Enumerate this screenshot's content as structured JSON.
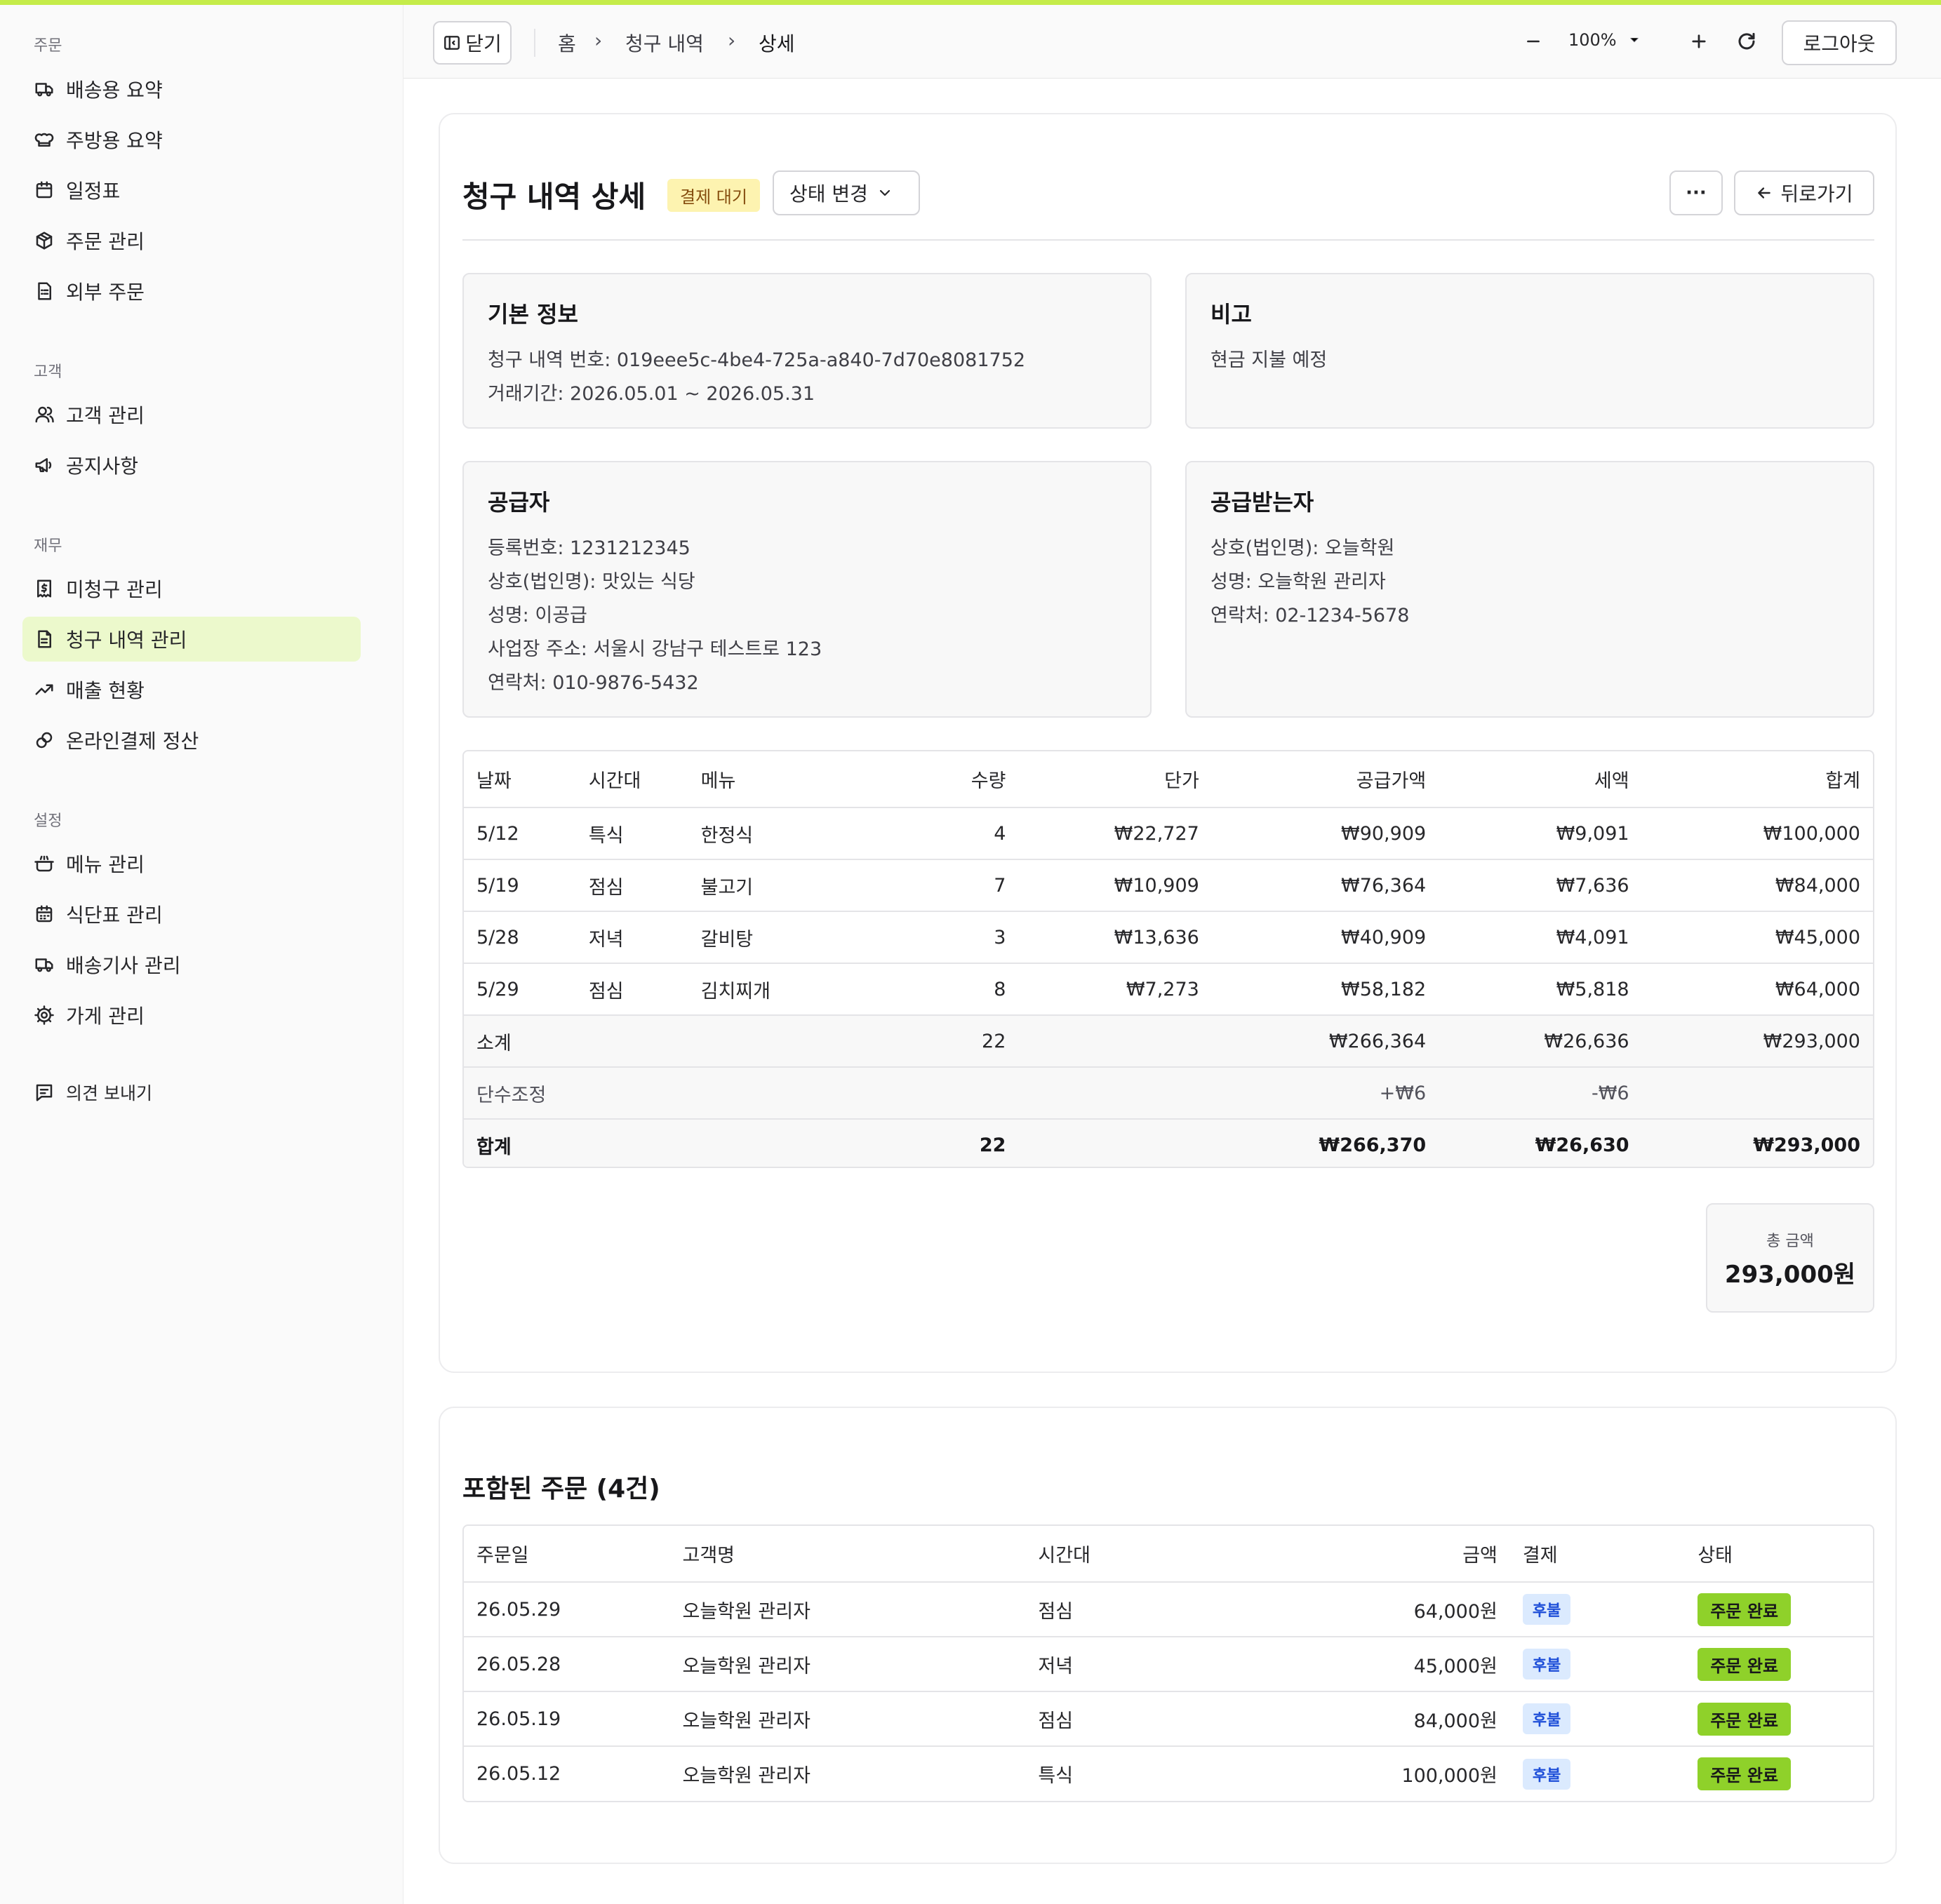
{
  "sidebar": {
    "sections": [
      {
        "title": "주문",
        "items": [
          {
            "label": "배송용 요약",
            "icon": "truck-icon"
          },
          {
            "label": "주방용 요약",
            "icon": "chef-hat-icon"
          },
          {
            "label": "일정표",
            "icon": "calendar-icon"
          },
          {
            "label": "주문 관리",
            "icon": "package-icon"
          },
          {
            "label": "외부 주문",
            "icon": "document-list-icon"
          }
        ]
      },
      {
        "title": "고객",
        "items": [
          {
            "label": "고객 관리",
            "icon": "user-icon"
          },
          {
            "label": "공지사항",
            "icon": "megaphone-icon"
          }
        ]
      },
      {
        "title": "재무",
        "items": [
          {
            "label": "미청구 관리",
            "icon": "receipt-dollar-icon"
          },
          {
            "label": "청구 내역 관리",
            "icon": "document-icon",
            "active": true
          },
          {
            "label": "매출 현황",
            "icon": "trending-up-icon"
          },
          {
            "label": "온라인결제 정산",
            "icon": "coins-icon"
          }
        ]
      },
      {
        "title": "설정",
        "items": [
          {
            "label": "메뉴 관리",
            "icon": "cooking-pot-icon"
          },
          {
            "label": "식단표 관리",
            "icon": "calendar-grid-icon"
          },
          {
            "label": "배송기사 관리",
            "icon": "truck-icon"
          },
          {
            "label": "가게 관리",
            "icon": "gear-icon"
          }
        ]
      }
    ],
    "feedback_label": "의견 보내기"
  },
  "topbar": {
    "close_label": "닫기",
    "breadcrumb": [
      "홈",
      "청구 내역",
      "상세"
    ],
    "zoom": "100%",
    "logout_label": "로그아웃"
  },
  "detail": {
    "title": "청구 내역 상세",
    "status_badge": "결제 대기",
    "status_change_label": "상태 변경",
    "more_label": "···",
    "back_label": "뒤로가기"
  },
  "basic_info": {
    "title": "기본 정보",
    "invoice_no": "청구 내역 번호: 019eee5c-4be4-725a-a840-7d70e8081752",
    "period": "거래기간: 2026.05.01 ~ 2026.05.31"
  },
  "note": {
    "title": "비고",
    "text": "현금 지불 예정"
  },
  "supplier": {
    "title": "공급자",
    "lines": [
      "등록번호: 1231212345",
      "상호(법인명): 맛있는 식당",
      "성명: 이공급",
      "사업장 주소: 서울시 강남구 테스트로 123",
      "연락처: 010-9876-5432"
    ]
  },
  "recipient": {
    "title": "공급받는자",
    "lines": [
      "상호(법인명): 오늘학원",
      "성명: 오늘학원 관리자",
      "연락처: 02-1234-5678"
    ]
  },
  "items_table": {
    "headers": [
      "날짜",
      "시간대",
      "메뉴",
      "수량",
      "단가",
      "공급가액",
      "세액",
      "합계"
    ],
    "rows": [
      [
        "5/12",
        "특식",
        "한정식",
        "4",
        "₩22,727",
        "₩90,909",
        "₩9,091",
        "₩100,000"
      ],
      [
        "5/19",
        "점심",
        "불고기",
        "7",
        "₩10,909",
        "₩76,364",
        "₩7,636",
        "₩84,000"
      ],
      [
        "5/28",
        "저녁",
        "갈비탕",
        "3",
        "₩13,636",
        "₩40,909",
        "₩4,091",
        "₩45,000"
      ],
      [
        "5/29",
        "점심",
        "김치찌개",
        "8",
        "₩7,273",
        "₩58,182",
        "₩5,818",
        "₩64,000"
      ]
    ],
    "subtotal": {
      "label": "소계",
      "qty": "22",
      "supply": "₩266,364",
      "tax": "₩26,636",
      "total": "₩293,000"
    },
    "rounding": {
      "label": "단수조정",
      "supply": "+₩6",
      "tax": "-₩6"
    },
    "total": {
      "label": "합계",
      "qty": "22",
      "supply": "₩266,370",
      "tax": "₩26,630",
      "total": "₩293,000"
    }
  },
  "grand_total": {
    "label": "총 금액",
    "value": "293,000원"
  },
  "orders": {
    "title": "포함된 주문 (4건)",
    "headers": [
      "주문일",
      "고객명",
      "시간대",
      "금액",
      "결제",
      "상태"
    ],
    "rows": [
      [
        "26.05.29",
        "오늘학원 관리자",
        "점심",
        "64,000원",
        "후불",
        "주문 완료"
      ],
      [
        "26.05.28",
        "오늘학원 관리자",
        "저녁",
        "45,000원",
        "후불",
        "주문 완료"
      ],
      [
        "26.05.19",
        "오늘학원 관리자",
        "점심",
        "84,000원",
        "후불",
        "주문 완료"
      ],
      [
        "26.05.12",
        "오늘학원 관리자",
        "특식",
        "100,000원",
        "후불",
        "주문 완료"
      ]
    ]
  },
  "colors": {
    "accent": "#c5ec4a",
    "active_nav_bg": "#ecf9cc",
    "pending_badge_bg": "#fdf3b0",
    "pay_badge_bg": "#dbeafe",
    "status_badge_bg": "#8fd12a"
  }
}
